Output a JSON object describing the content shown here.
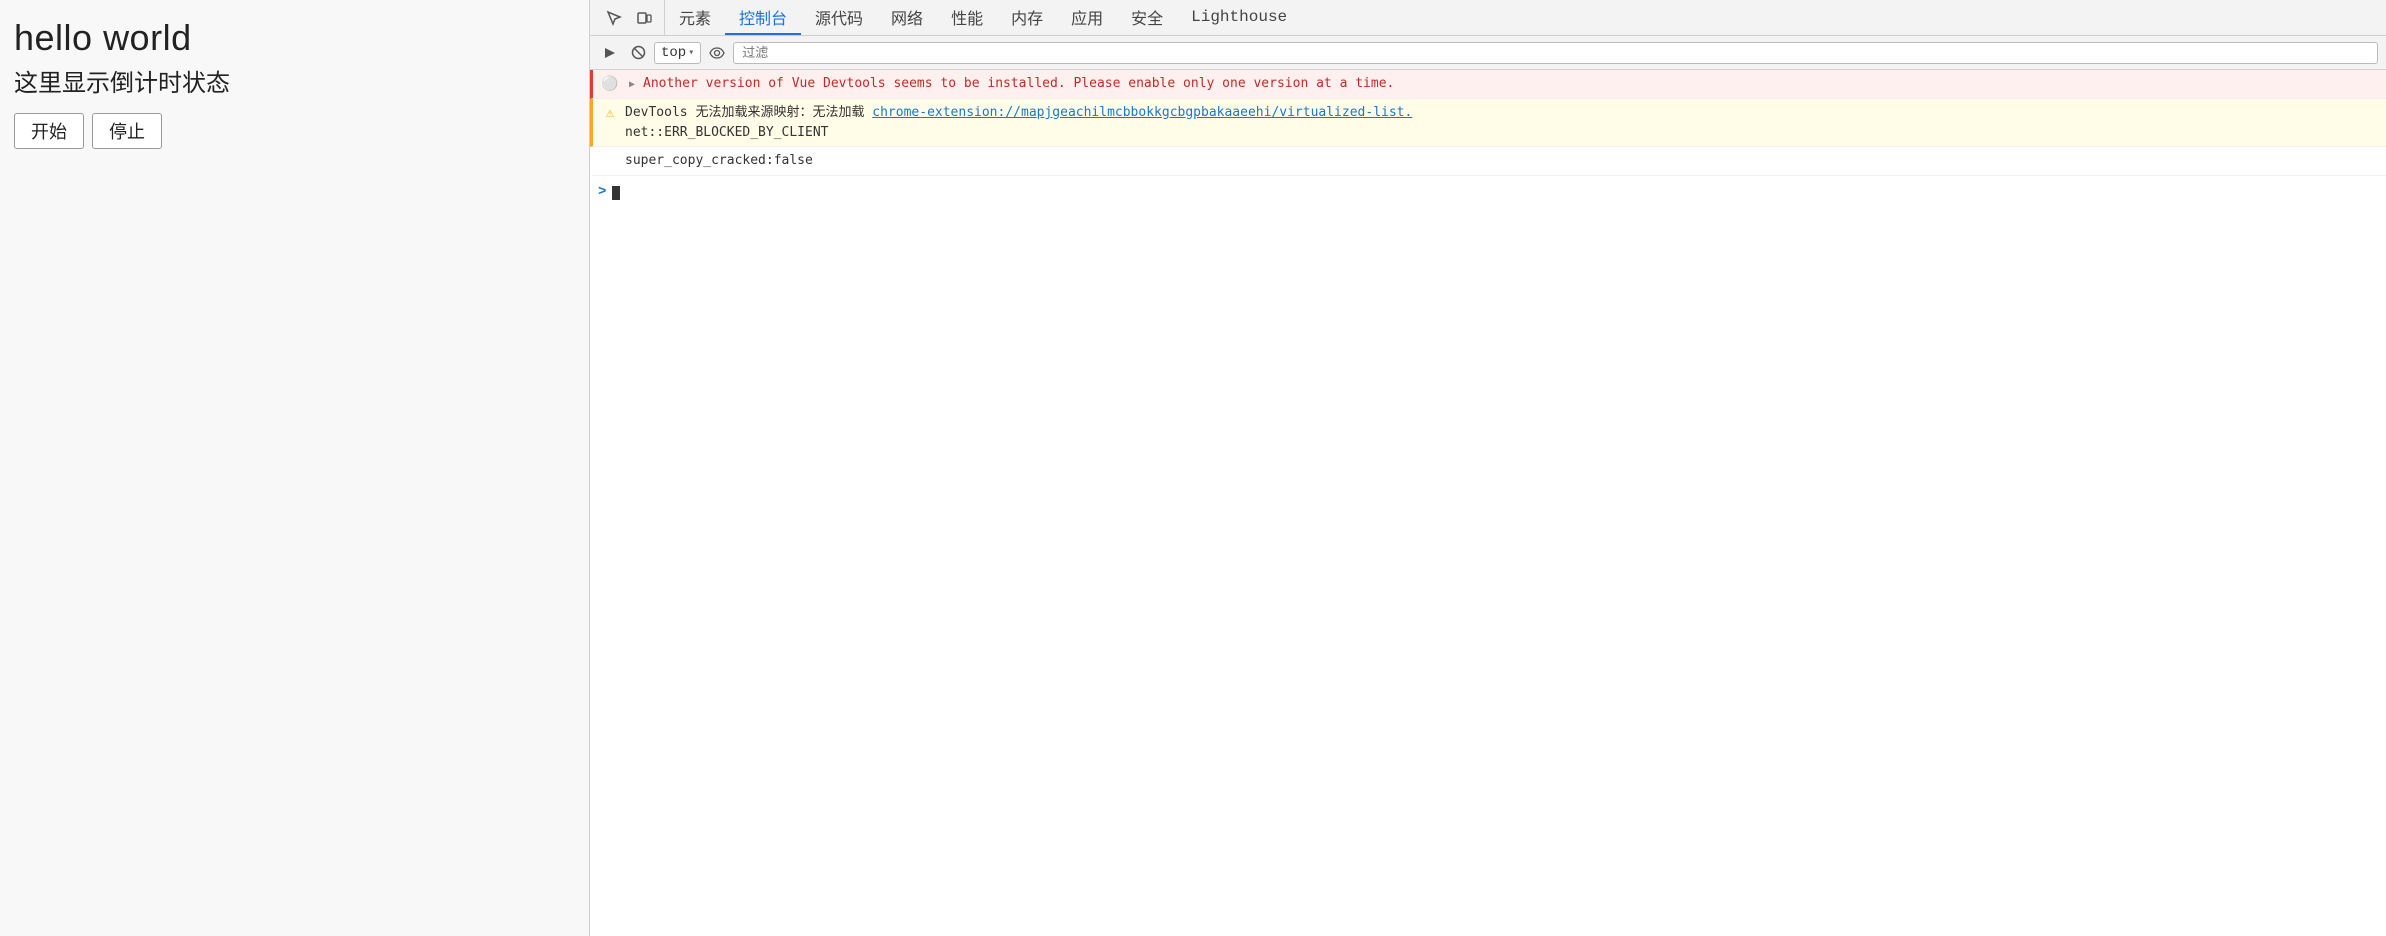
{
  "leftPanel": {
    "title": "hello world",
    "subtitle": "这里显示倒计时状态",
    "startButton": "开始",
    "stopButton": "停止"
  },
  "devtools": {
    "tabs": [
      {
        "label": "元素",
        "active": false
      },
      {
        "label": "控制台",
        "active": true
      },
      {
        "label": "源代码",
        "active": false
      },
      {
        "label": "网络",
        "active": false
      },
      {
        "label": "性能",
        "active": false
      },
      {
        "label": "内存",
        "active": false
      },
      {
        "label": "应用",
        "active": false
      },
      {
        "label": "安全",
        "active": false
      },
      {
        "label": "Lighthouse",
        "active": false
      }
    ],
    "toolbar": {
      "topDropdown": "top",
      "filterPlaceholder": "过滤"
    },
    "messages": [
      {
        "type": "error",
        "expandable": true,
        "text": "Another version of Vue Devtools seems to be installed. Please enable only one version at a time."
      },
      {
        "type": "warning",
        "expandable": false,
        "line1": "DevTools 无法加载来源映射：无法加载 ",
        "link": "chrome-extension://mapjgeachilmcbbokkgcbgpbakaaeehi/virtualized-list.",
        "line2": "net::ERR_BLOCKED_BY_CLIENT"
      },
      {
        "type": "info",
        "text": "super_copy_cracked:false"
      }
    ]
  }
}
